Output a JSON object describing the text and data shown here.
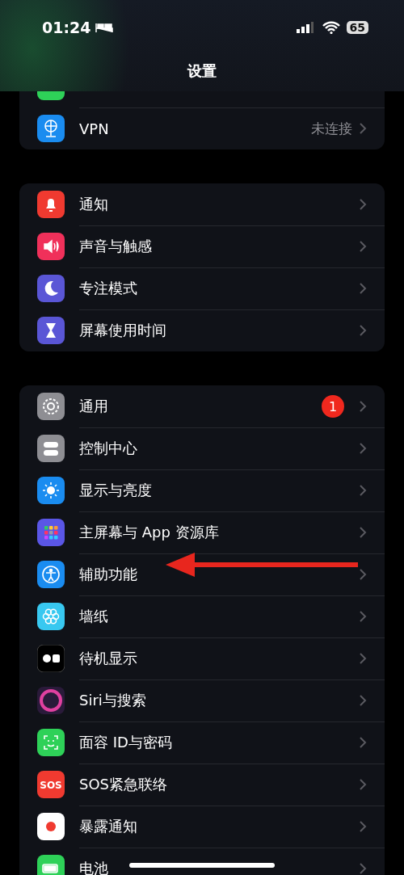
{
  "status_bar": {
    "time": "01:24",
    "battery": "65"
  },
  "title": "设置",
  "groups": [
    {
      "partial_top": true,
      "items": [
        {
          "label": "VPN",
          "value": "未连接",
          "kind": "globe",
          "color": "#1a8cf0"
        }
      ]
    },
    {
      "items": [
        {
          "label": "通知",
          "kind": "bell",
          "color": "#f03a30"
        },
        {
          "label": "声音与触感",
          "kind": "speaker",
          "color": "#f0305a"
        },
        {
          "label": "专注模式",
          "kind": "moon",
          "color": "#5a56d6"
        },
        {
          "label": "屏幕使用时间",
          "kind": "hourglass",
          "color": "#5a56d6"
        }
      ]
    },
    {
      "items": [
        {
          "label": "通用",
          "kind": "gear",
          "color": "#8e8e93",
          "badge": "1"
        },
        {
          "label": "控制中心",
          "kind": "toggles",
          "color": "#8e8e93"
        },
        {
          "label": "显示与亮度",
          "kind": "sun",
          "color": "#1a8cf0"
        },
        {
          "label": "主屏幕与 App 资源库",
          "kind": "grid",
          "color": "#5a56e6"
        },
        {
          "label": "辅助功能",
          "kind": "person",
          "color": "#1a8cf0",
          "pointed": true
        },
        {
          "label": "墙纸",
          "kind": "flower",
          "color": "#38c8f0"
        },
        {
          "label": "待机显示",
          "kind": "standby",
          "color": "#000000"
        },
        {
          "label": "Siri与搜索",
          "kind": "orb",
          "color": "#2a1a3a"
        },
        {
          "label": "面容 ID与密码",
          "kind": "face",
          "color": "#2ed158"
        },
        {
          "label": "SOS紧急联络",
          "kind": "sos",
          "icon_text": "SOS",
          "color": "#f03a30"
        },
        {
          "label": "暴露通知",
          "kind": "dot",
          "color": "#ffffff"
        },
        {
          "label": "电池",
          "kind": "battery",
          "color": "#2ed158"
        }
      ]
    }
  ]
}
